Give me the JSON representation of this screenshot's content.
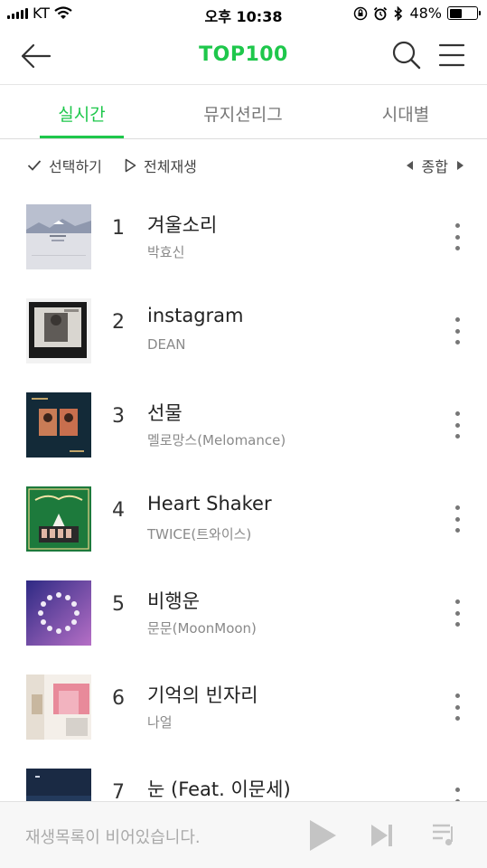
{
  "status_bar": {
    "carrier": "KT",
    "time": "오후 10:38",
    "battery": "48%",
    "battery_level": 0.48
  },
  "header": {
    "title": "TOP100",
    "back_icon": "back-arrow-icon",
    "search_icon": "search-icon",
    "menu_icon": "hamburger-menu-icon"
  },
  "tabs": [
    {
      "label": "실시간",
      "active": true
    },
    {
      "label": "뮤지션리그",
      "active": false
    },
    {
      "label": "시대별",
      "active": false
    }
  ],
  "toolbar": {
    "select_label": "선택하기",
    "play_all_label": "전체재생",
    "sort_label": "종합"
  },
  "chart": [
    {
      "rank": "1",
      "title": "겨울소리",
      "artist": "박효신"
    },
    {
      "rank": "2",
      "title": "instagram",
      "artist": "DEAN"
    },
    {
      "rank": "3",
      "title": "선물",
      "artist": "멜로망스(Melomance)"
    },
    {
      "rank": "4",
      "title": "Heart Shaker",
      "artist": "TWICE(트와이스)"
    },
    {
      "rank": "5",
      "title": "비행운",
      "artist": "문문(MoonMoon)"
    },
    {
      "rank": "6",
      "title": "기억의 빈자리",
      "artist": "나얼"
    },
    {
      "rank": "7",
      "title": "눈 (Feat. 이문세)",
      "artist": ""
    }
  ],
  "player": {
    "empty_message": "재생목록이 비어있습니다."
  },
  "colors": {
    "accent": "#1ec74b"
  }
}
